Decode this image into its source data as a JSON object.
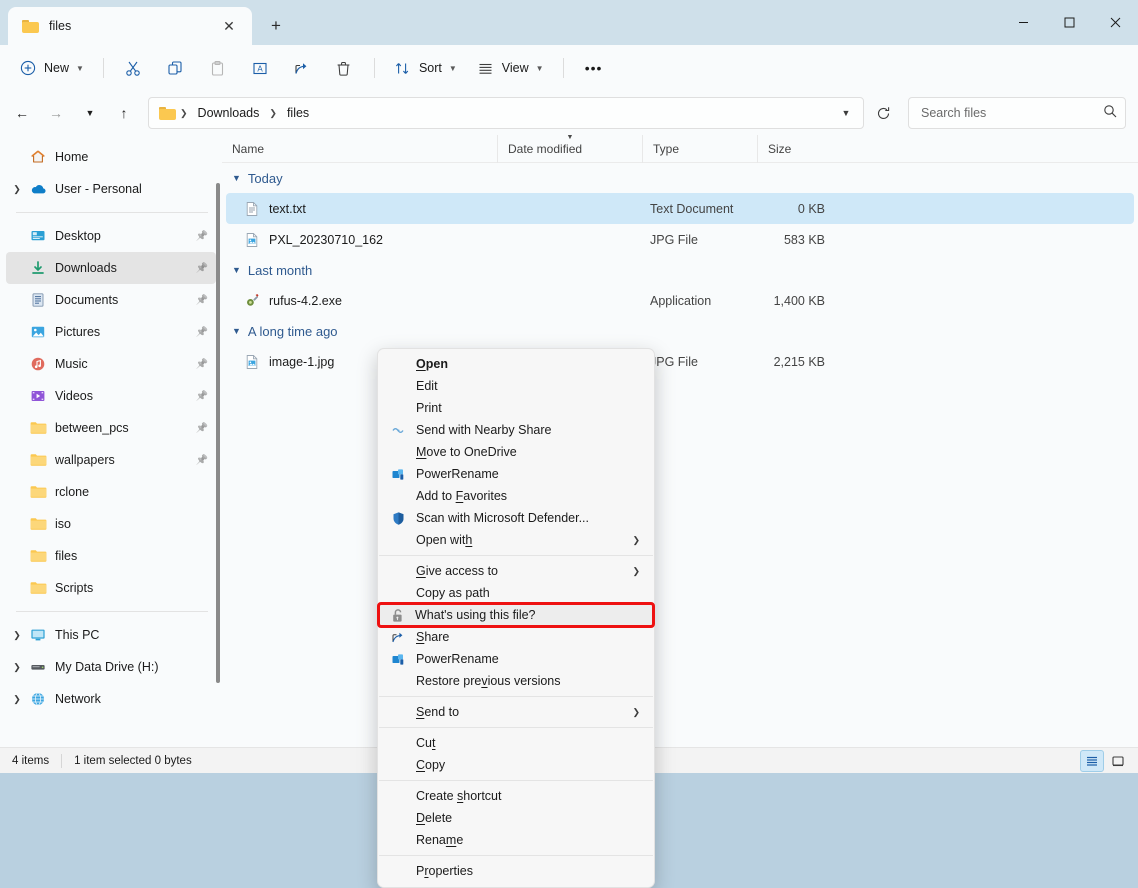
{
  "window": {
    "tab_title": "files",
    "close_tab_icon": "close-icon",
    "new_tab_icon": "plus-icon",
    "minimize": "–",
    "maximize": "☐",
    "close": "✕"
  },
  "toolbar": {
    "new_label": "New",
    "cut_icon": "scissors-icon",
    "copy_icon": "copy-icon",
    "paste_icon": "paste-icon",
    "rename_icon": "rename-icon",
    "share_icon": "share-icon",
    "delete_icon": "trash-icon",
    "sort_label": "Sort",
    "view_label": "View",
    "more_label": "•••"
  },
  "address": {
    "back_icon": "arrow-left-icon",
    "forward_icon": "arrow-right-icon",
    "recent_icon": "chevron-down-icon",
    "up_icon": "arrow-up-icon",
    "crumbs": [
      "Downloads",
      "files"
    ],
    "dropdown_icon": "chevron-down-icon",
    "refresh_icon": "refresh-icon"
  },
  "search": {
    "placeholder": "Search files",
    "value": "",
    "icon": "search-icon"
  },
  "sidebar": {
    "items": [
      {
        "label": "Home",
        "icon": "home-icon",
        "expandable": false,
        "pinned": false,
        "selected": false
      },
      {
        "label": "User - Personal",
        "icon": "onedrive-icon",
        "expandable": true,
        "pinned": false,
        "selected": false
      },
      {
        "divider": true
      },
      {
        "label": "Desktop",
        "icon": "desktop-icon",
        "expandable": false,
        "pinned": true,
        "selected": false
      },
      {
        "label": "Downloads",
        "icon": "downloads-icon",
        "expandable": false,
        "pinned": true,
        "selected": true
      },
      {
        "label": "Documents",
        "icon": "documents-icon",
        "expandable": false,
        "pinned": true,
        "selected": false
      },
      {
        "label": "Pictures",
        "icon": "pictures-icon",
        "expandable": false,
        "pinned": true,
        "selected": false
      },
      {
        "label": "Music",
        "icon": "music-icon",
        "expandable": false,
        "pinned": true,
        "selected": false
      },
      {
        "label": "Videos",
        "icon": "videos-icon",
        "expandable": false,
        "pinned": true,
        "selected": false
      },
      {
        "label": "between_pcs",
        "icon": "folder-icon",
        "expandable": false,
        "pinned": true,
        "selected": false
      },
      {
        "label": "wallpapers",
        "icon": "folder-icon",
        "expandable": false,
        "pinned": true,
        "selected": false
      },
      {
        "label": "rclone",
        "icon": "folder-icon",
        "expandable": false,
        "pinned": false,
        "selected": false
      },
      {
        "label": "iso",
        "icon": "folder-icon",
        "expandable": false,
        "pinned": false,
        "selected": false
      },
      {
        "label": "files",
        "icon": "folder-icon",
        "expandable": false,
        "pinned": false,
        "selected": false
      },
      {
        "label": "Scripts",
        "icon": "folder-icon",
        "expandable": false,
        "pinned": false,
        "selected": false
      },
      {
        "divider": true
      },
      {
        "label": "This PC",
        "icon": "pc-icon",
        "expandable": true,
        "pinned": false,
        "selected": false
      },
      {
        "label": "My Data Drive (H:)",
        "icon": "drive-icon",
        "expandable": true,
        "pinned": false,
        "selected": false
      },
      {
        "label": "Network",
        "icon": "network-icon",
        "expandable": true,
        "pinned": false,
        "selected": false
      }
    ]
  },
  "filelist": {
    "columns": {
      "name": "Name",
      "date": "Date modified",
      "type": "Type",
      "size": "Size"
    },
    "sort_column": "date",
    "groups": [
      {
        "label": "Today",
        "rows": [
          {
            "name": "text.txt",
            "icon": "text-file-icon",
            "date": "",
            "type": "Text Document",
            "size": "0 KB",
            "selected": true
          },
          {
            "name": "PXL_20230710_162",
            "icon": "image-file-icon",
            "date": "",
            "type": "JPG File",
            "size": "583 KB",
            "selected": false
          }
        ]
      },
      {
        "label": "Last month",
        "rows": [
          {
            "name": "rufus-4.2.exe",
            "icon": "exe-file-icon",
            "date": "",
            "type": "Application",
            "size": "1,400 KB",
            "selected": false
          }
        ]
      },
      {
        "label": "A long time ago",
        "rows": [
          {
            "name": "image-1.jpg",
            "icon": "image-file-icon",
            "date": "",
            "type": "JPG File",
            "size": "2,215 KB",
            "selected": false
          }
        ]
      }
    ]
  },
  "context_menu": {
    "highlight_color": "#ee1111",
    "items": [
      {
        "label": "Open",
        "icon": "",
        "bold": true,
        "accel": "O",
        "submenu": false
      },
      {
        "label": "Edit",
        "icon": "",
        "bold": false,
        "accel": "",
        "submenu": false
      },
      {
        "label": "Print",
        "icon": "",
        "bold": false,
        "accel": "",
        "submenu": false
      },
      {
        "label": "Send with Nearby Share",
        "icon": "nearby-share-icon",
        "bold": false,
        "accel": "",
        "submenu": false
      },
      {
        "label": "Move to OneDrive",
        "icon": "",
        "bold": false,
        "accel": "M",
        "submenu": false
      },
      {
        "label": "PowerRename",
        "icon": "powerrename-icon",
        "bold": false,
        "accel": "",
        "submenu": false
      },
      {
        "label": "Add to Favorites",
        "icon": "",
        "bold": false,
        "accel": "F",
        "submenu": false
      },
      {
        "label": "Scan with Microsoft Defender...",
        "icon": "defender-shield-icon",
        "bold": false,
        "accel": "",
        "submenu": false
      },
      {
        "label": "Open with",
        "icon": "",
        "bold": false,
        "accel": "h",
        "submenu": true
      },
      {
        "separator": true
      },
      {
        "label": "Give access to",
        "icon": "",
        "bold": false,
        "accel": "G",
        "submenu": true
      },
      {
        "label": "Copy as path",
        "icon": "",
        "bold": false,
        "accel": "",
        "submenu": false
      },
      {
        "label": "What's using this file?",
        "icon": "unlock-icon",
        "bold": false,
        "accel": "",
        "submenu": false,
        "highlighted": true
      },
      {
        "label": "Share",
        "icon": "share-icon",
        "bold": false,
        "accel": "S",
        "submenu": false
      },
      {
        "label": "PowerRename",
        "icon": "powerrename-icon",
        "bold": false,
        "accel": "",
        "submenu": false
      },
      {
        "label": "Restore previous versions",
        "icon": "",
        "bold": false,
        "accel": "v",
        "submenu": false
      },
      {
        "separator": true
      },
      {
        "label": "Send to",
        "icon": "",
        "bold": false,
        "accel": "S",
        "submenu": true
      },
      {
        "separator": true
      },
      {
        "label": "Cut",
        "icon": "",
        "bold": false,
        "accel": "t",
        "submenu": false
      },
      {
        "label": "Copy",
        "icon": "",
        "bold": false,
        "accel": "C",
        "submenu": false
      },
      {
        "separator": true
      },
      {
        "label": "Create shortcut",
        "icon": "",
        "bold": false,
        "accel": "s",
        "submenu": false
      },
      {
        "label": "Delete",
        "icon": "",
        "bold": false,
        "accel": "D",
        "submenu": false
      },
      {
        "label": "Rename",
        "icon": "",
        "bold": false,
        "accel": "m",
        "submenu": false
      },
      {
        "separator": true
      },
      {
        "label": "Properties",
        "icon": "",
        "bold": false,
        "accel": "r",
        "submenu": false
      }
    ]
  },
  "statusbar": {
    "item_count": "4 items",
    "selection": "1 item selected  0 bytes",
    "details_view_icon": "details-view-icon",
    "large_icons_view_icon": "large-icons-view-icon"
  }
}
